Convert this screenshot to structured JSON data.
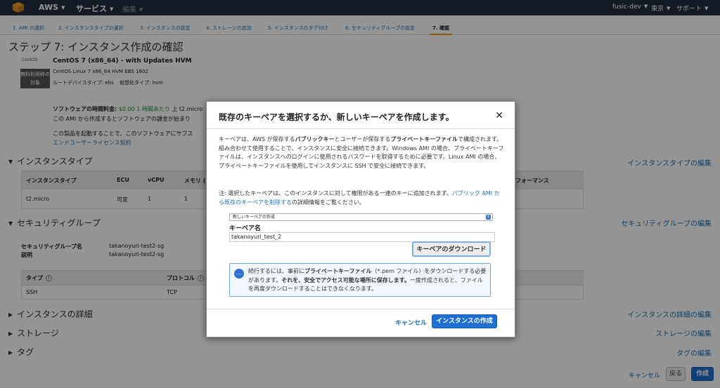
{
  "topnav": {
    "brand": "AWS",
    "services": "サービス",
    "edit": "編集",
    "account": "fusic-dev",
    "region": "東京",
    "support": "サポート"
  },
  "wizard": {
    "steps": [
      "1. AMI の選択",
      "2. インスタンスタイプの選択",
      "3. インスタンスの設定",
      "4. ストレージの追加",
      "5. インスタンスのタグ付け",
      "6. セキュリティグループの設定",
      "7. 確認"
    ]
  },
  "page": {
    "title": "ステップ 7: インスタンス作成の確認"
  },
  "ami": {
    "logo_text": "CentOS",
    "badge": "無料利用枠の対象",
    "name": "CentOS 7 (x86_64) - with Updates HVM",
    "desc": "CentOS Linux 7 x86_64 HVM EBS 1602",
    "rootdev": "ルートデバイスタイプ: ebs",
    "virt": "仮想化タイプ: hvm"
  },
  "software": {
    "hourly_label": "ソフトウェアの時間料金:",
    "hourly_value": "$0.00 1 時間あたり",
    "hourly_tail": "上 t2.micro",
    "line2": "この AMI から作成するとソフトウェアの課金が始まり",
    "line3": "この製品を起動することで、このソフトウェアにサブス",
    "eula": "エンドユーザーライセンス契約"
  },
  "sections": {
    "instance_type": {
      "title": "インスタンスタイプ",
      "edit": "インスタンスタイプの編集",
      "headers": [
        "インスタンスタイプ",
        "ECU",
        "vCPU",
        "メモリ (",
        "フォーマンス"
      ],
      "row": [
        "t2.micro",
        "可変",
        "1",
        "1"
      ]
    },
    "security": {
      "title": "セキュリティグループ",
      "edit": "セキュリティグループの編集",
      "name_label": "セキュリティグループ名",
      "name_value": "takanoyuri-test2-sg",
      "desc_label": "説明",
      "desc_value": "takanoyuri-test2-sg",
      "headers": [
        "タイプ",
        "プロトコル"
      ],
      "row": [
        "SSH",
        "TCP"
      ]
    },
    "details": {
      "title": "インスタンスの詳細",
      "edit": "インスタンスの詳細の編集"
    },
    "storage": {
      "title": "ストレージ",
      "edit": "ストレージの編集"
    },
    "tags": {
      "title": "タグ",
      "edit": "タグの編集"
    }
  },
  "footer": {
    "cancel": "キャンセル",
    "back": "戻る",
    "launch": "作成"
  },
  "modal": {
    "title": "既存のキーペアを選択するか、新しいキーペアを作成します。",
    "close": "✕",
    "p1_a": "キーペアは、AWS が保存する",
    "p1_b": "パブリックキー",
    "p1_c": "とユーザーが保存する",
    "p1_d": "プライベートキーファイル",
    "p1_e": "で構成されます。組み合わせて使用することで、インスタンスに安全に接続できます。Windows AMI の場合、プライベートキーファイルは、インスタンスへのログインに使用されるパスワードを取得するために必要です。Linux AMI の場合、プライベートキーファイルを使用してインスタンスに SSH で安全に接続できます。",
    "p2_a": "注: 選択したキーペアは、このインスタンスに対して権限がある一連のキーに追加されます。",
    "p2_link": "パブリック AMI から既存のキーペアを削除する",
    "p2_b": "の詳細情報をご覧ください。",
    "select_value": "新しいキーペアの作成",
    "keypair_label": "キーペア名",
    "keypair_value": "takanoyuri_test_2",
    "download": "キーペアのダウンロード",
    "alert_a": "続行するには、事前に",
    "alert_b": "プライベートキーファイル",
    "alert_c": "（*.pem ファイル）をダウンロードする必要があります。",
    "alert_d": "それを、安全でアクセス可能な場所に保存します。",
    "alert_e": "一度作成されると、ファイルを再度ダウンロードすることはできなくなります。",
    "cancel": "キャンセル",
    "launch": "インスタンスの作成"
  }
}
